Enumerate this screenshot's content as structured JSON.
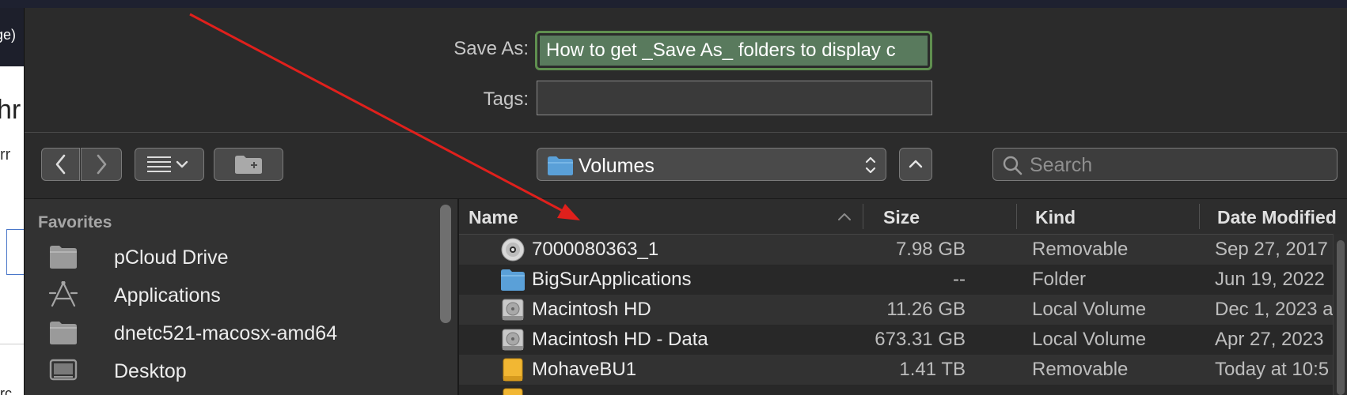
{
  "background_window": {
    "title_fragment": "ge)",
    "heading_fragment": "hr",
    "text_fragment": "rr",
    "bottom_fragment": "rc"
  },
  "save": {
    "saveas_label": "Save As:",
    "saveas_value": "How to get _Save As_ folders to display c",
    "tags_label": "Tags:",
    "tags_value": ""
  },
  "toolbar": {
    "back_icon": "chevron-left-icon",
    "forward_icon": "chevron-right-icon",
    "view_icon": "list-view-icon",
    "new_folder_icon": "new-folder-icon",
    "location": "Volumes",
    "search_placeholder": "Search"
  },
  "sidebar": {
    "heading": "Favorites",
    "items": [
      {
        "label": "pCloud Drive",
        "icon": "folder-icon"
      },
      {
        "label": "Applications",
        "icon": "applications-icon"
      },
      {
        "label": "dnetc521-macosx-amd64",
        "icon": "folder-icon"
      },
      {
        "label": "Desktop",
        "icon": "desktop-icon"
      }
    ]
  },
  "filelist": {
    "columns": {
      "name": "Name",
      "size": "Size",
      "kind": "Kind",
      "date": "Date Modified"
    },
    "rows": [
      {
        "name": "7000080363_1",
        "size": "7.98 GB",
        "kind": "Removable",
        "date": "Sep 27, 2017",
        "icon": "disc-icon"
      },
      {
        "name": "BigSurApplications",
        "size": "--",
        "kind": "Folder",
        "date": "Jun 19, 2022",
        "icon": "folder-icon"
      },
      {
        "name": "Macintosh HD",
        "size": "11.26 GB",
        "kind": "Local Volume",
        "date": "Dec 1, 2023 a",
        "icon": "drive-icon"
      },
      {
        "name": "Macintosh HD - Data",
        "size": "673.31 GB",
        "kind": "Local Volume",
        "date": "Apr 27, 2023",
        "icon": "drive-icon"
      },
      {
        "name": "MohaveBU1",
        "size": "1.41 TB",
        "kind": "Removable",
        "date": "Today at 10:5",
        "icon": "external-drive-icon"
      }
    ]
  },
  "colors": {
    "accent_green": "#5f8f4f",
    "annotation_arrow": "#e0201c",
    "folder_blue": "#5aa0d8"
  }
}
